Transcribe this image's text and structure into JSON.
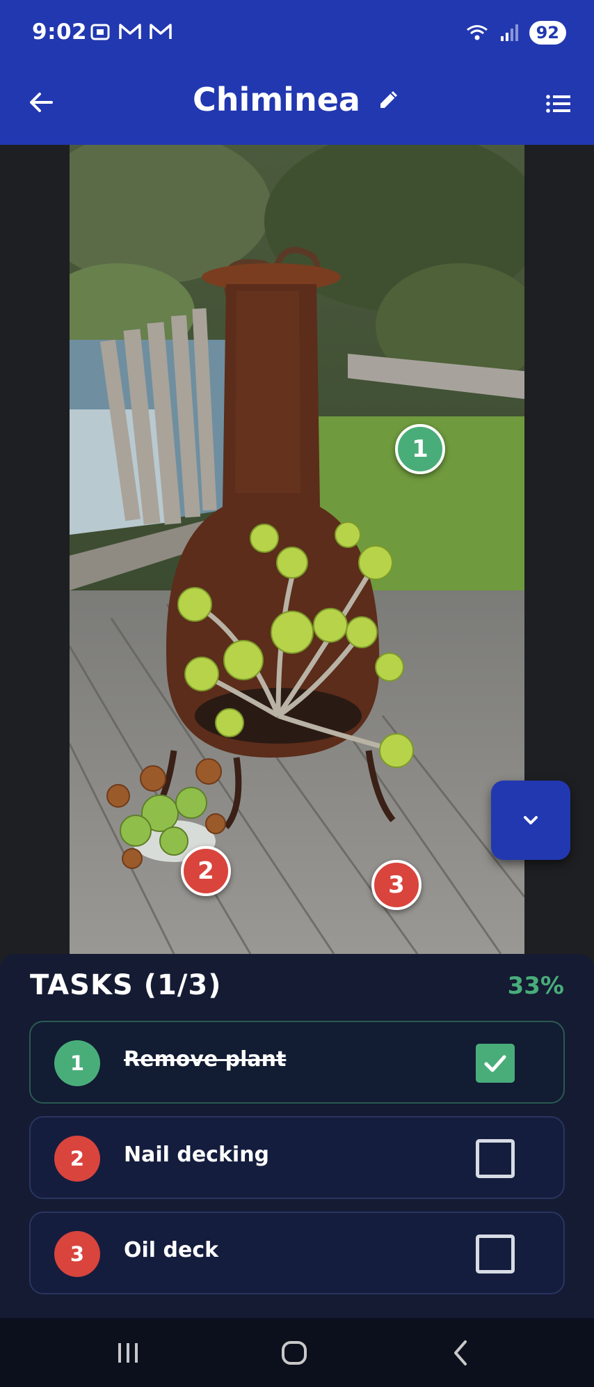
{
  "status_bar": {
    "time": "9:02",
    "left_icons": [
      "screenshot-icon",
      "gmail-icon",
      "gmail-icon"
    ],
    "right_icons": [
      "wifi-icon",
      "signal-icon"
    ],
    "battery": "92"
  },
  "app_bar": {
    "title": "Chiminea",
    "back_icon": "arrow-left-icon",
    "edit_icon": "pencil-icon",
    "list_icon": "list-icon"
  },
  "photo": {
    "markers": [
      {
        "number": "1",
        "color": "green"
      },
      {
        "number": "2",
        "color": "red"
      },
      {
        "number": "3",
        "color": "red"
      }
    ]
  },
  "fab": {
    "icon": "chevron-down-icon"
  },
  "tasks": {
    "heading": "TASKS (1/3)",
    "percent": "33%",
    "items": [
      {
        "number": "1",
        "label": "Remove plant",
        "done": true,
        "color": "#49ad7a"
      },
      {
        "number": "2",
        "label": "Nail decking",
        "done": false,
        "color": "#d9443d"
      },
      {
        "number": "3",
        "label": "Oil deck",
        "done": false,
        "color": "#d9443d"
      }
    ]
  },
  "colors": {
    "accent": "#2238b0",
    "green": "#49ad7a",
    "red": "#d9443d",
    "panel": "#141b33"
  }
}
